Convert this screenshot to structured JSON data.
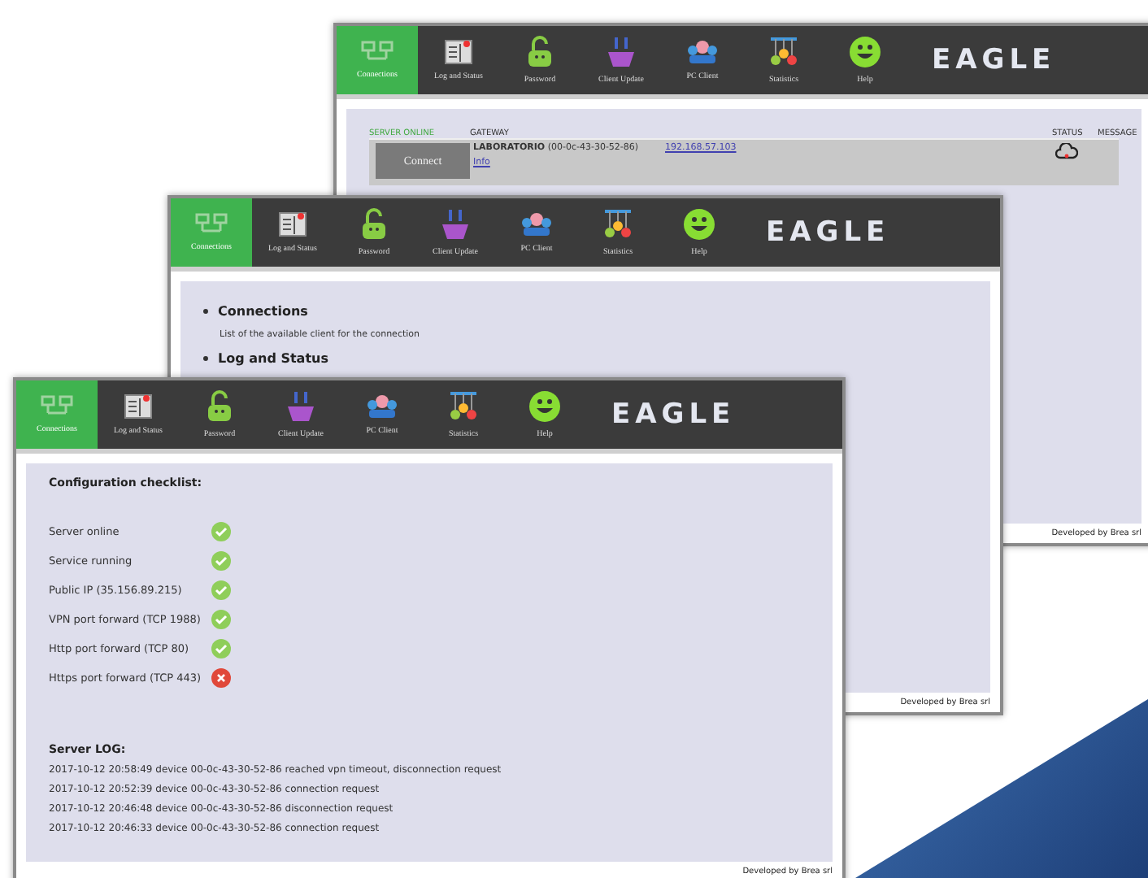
{
  "windows": [
    {
      "kind": "gateways",
      "nav": [
        {
          "label": "Connections",
          "selected": true
        },
        {
          "label": "Log and Status",
          "selected": false
        },
        {
          "label": "Password",
          "selected": false
        },
        {
          "label": "Client Update",
          "selected": false
        },
        {
          "label": "PC Client",
          "selected": false
        },
        {
          "label": "Statistics",
          "selected": false
        },
        {
          "label": "Help",
          "selected": false
        }
      ],
      "logo": "EAGLE",
      "columns": [
        "SERVER ONLINE",
        "GATEWAY",
        "STATUS",
        "MESSAGE"
      ],
      "rows": [
        {
          "button": "Connect",
          "connected": false,
          "name": "LABORATORIO",
          "mac": "(00-0c-43-30-52-86)",
          "link": "Info",
          "ip": "192.168.57.103"
        }
      ],
      "footer": "Developed by Brea srl"
    },
    {
      "kind": "help",
      "nav": [
        {
          "label": "Connections",
          "selected": true
        },
        {
          "label": "Log and Status",
          "selected": false
        },
        {
          "label": "Password",
          "selected": false
        },
        {
          "label": "Client Update",
          "selected": false
        },
        {
          "label": "PC Client",
          "selected": false
        },
        {
          "label": "Statistics",
          "selected": false
        },
        {
          "label": "Help",
          "selected": false
        }
      ],
      "logo": "EAGLE",
      "sections": [
        {
          "title": "Connections",
          "text": "List of the available client for the connection"
        },
        {
          "title": "Log and Status"
        }
      ],
      "footer": "Developed by Brea srl"
    },
    {
      "kind": "checklist",
      "nav": [
        {
          "label": "Connections",
          "selected": true
        },
        {
          "label": "Log and Status",
          "selected": false
        },
        {
          "label": "Password",
          "selected": false
        },
        {
          "label": "Client Update",
          "selected": false
        },
        {
          "label": "PC Client",
          "selected": false
        },
        {
          "label": "Statistics",
          "selected": false
        },
        {
          "label": "Help",
          "selected": false
        }
      ],
      "logo": "EAGLE",
      "checklist_title": "Configuration checklist:",
      "checks": [
        {
          "label": "Server online",
          "ok": true
        },
        {
          "label": "Service running",
          "ok": true
        },
        {
          "label": "Public IP (35.156.89.215)",
          "ok": true
        },
        {
          "label": "VPN port forward (TCP 1988)",
          "ok": true
        },
        {
          "label": "Http port forward (TCP 80)",
          "ok": true
        },
        {
          "label": "Https port forward (TCP 443)",
          "ok": false
        }
      ],
      "log_title": "Server LOG:",
      "log": [
        "2017-10-12 20:58:49 device 00-0c-43-30-52-86 reached vpn timeout, disconnection request",
        "2017-10-12 20:52:39 device 00-0c-43-30-52-86 connection request",
        "2017-10-12 20:46:48 device 00-0c-43-30-52-86 disconnection request",
        "2017-10-12 20:46:33 device 00-0c-43-30-52-86 connection request"
      ],
      "footer": "Developed by Brea srl"
    }
  ]
}
